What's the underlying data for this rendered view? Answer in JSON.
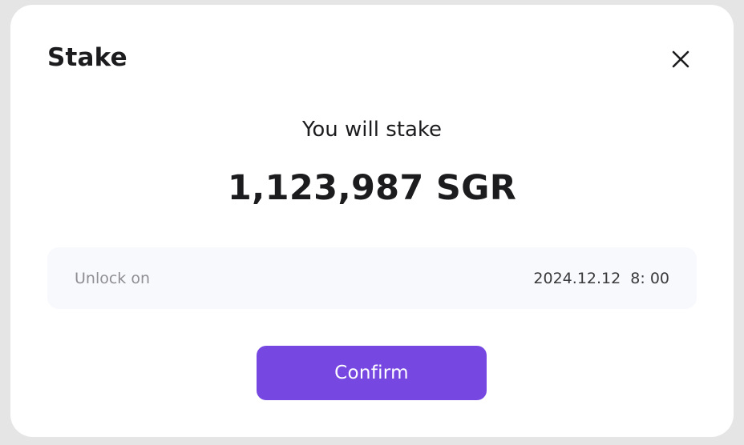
{
  "modal": {
    "title": "Stake",
    "close_icon": "close-icon"
  },
  "summary": {
    "intro": "You will stake",
    "amount": "1,123,987 SGR"
  },
  "unlock": {
    "label": "Unlock on",
    "value": "2024.12.12  8: 00"
  },
  "actions": {
    "confirm_label": "Confirm"
  },
  "colors": {
    "accent": "#7748e1",
    "panel_bg": "#f8f9fc",
    "text_primary": "#1c1c1e",
    "text_muted": "#8e8e93"
  }
}
